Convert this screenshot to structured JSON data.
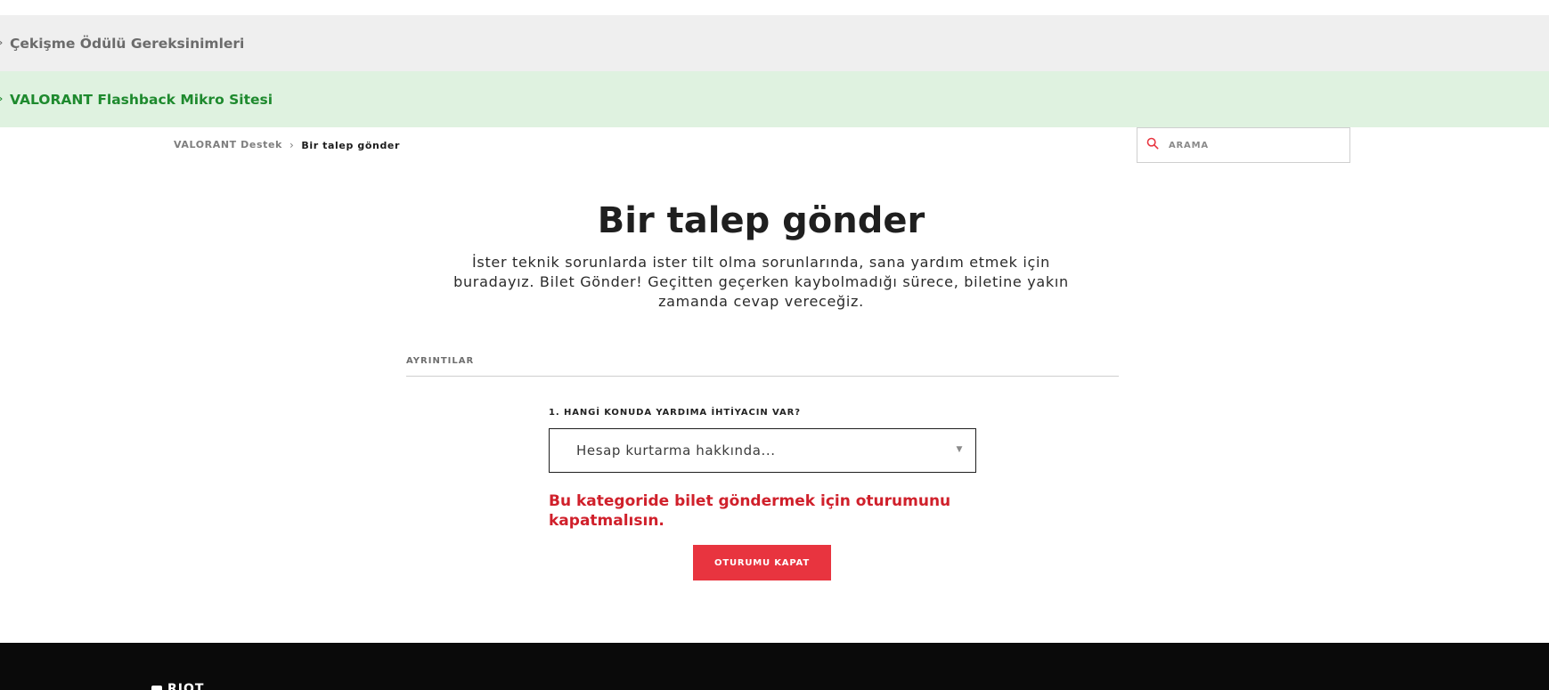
{
  "banners": {
    "requirements": "Çekişme Ödülü Gereksinimleri",
    "flashback": "VALORANT Flashback Mikro Sitesi"
  },
  "breadcrumb": {
    "home": "VALORANT Destek",
    "separator": "›",
    "current": "Bir talep gönder"
  },
  "search": {
    "placeholder": "ARAMA",
    "icon": "search-icon"
  },
  "hero": {
    "title": "Bir talep gönder",
    "subtitle": "İster teknik sorunlarda ister tilt olma sorunlarında, sana yardım etmek için buradayız. Bilet Gönder! Geçitten geçerken kaybolmadığı sürece, biletine yakın zamanda cevap vereceğiz."
  },
  "form": {
    "section_label": "AYRINTILAR",
    "question_label": "1. HANGİ KONUDA YARDIMA İHTİYACIN VAR?",
    "selected_value": "Hesap kurtarma hakkında...",
    "error_message": "Bu kategoride bilet göndermek için oturumunu kapatmalısın.",
    "logout_label": "OTURUMU KAPAT"
  },
  "footer": {
    "logo_text": "RIOT"
  },
  "colors": {
    "accent_red": "#e8343f",
    "error_red": "#d0202b",
    "green_banner_bg": "#dff2e0",
    "green_banner_text": "#1e8a2e",
    "gray_banner_bg": "#efefef",
    "footer_bg": "#0a0a0a"
  }
}
